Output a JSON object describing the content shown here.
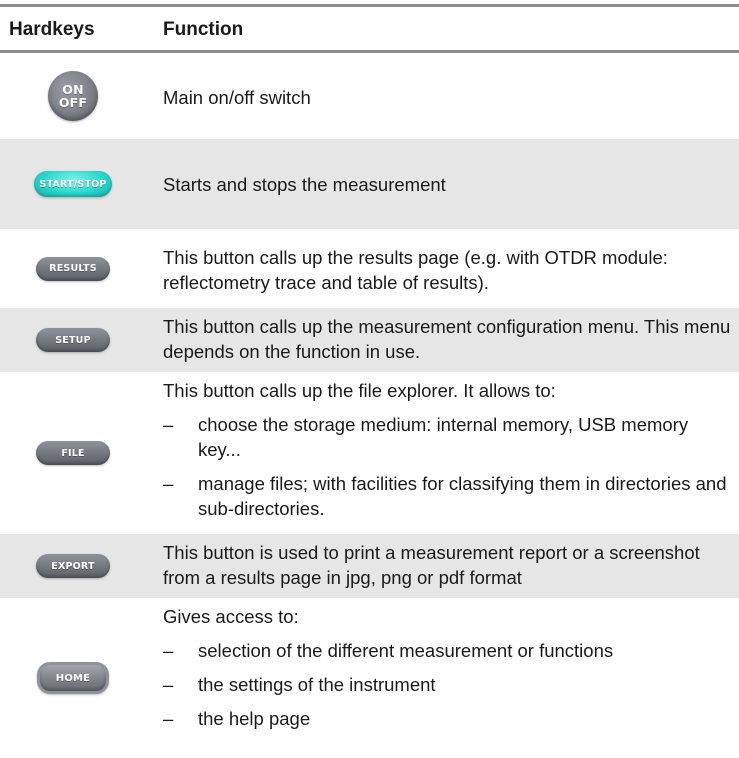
{
  "header": {
    "col1": "Hardkeys",
    "col2": "Function"
  },
  "rows": [
    {
      "key_label_top": "ON",
      "key_label_bottom": "OFF",
      "text": "Main on/off switch"
    },
    {
      "key_label": "START/STOP",
      "text": "Starts and stops the measurement"
    },
    {
      "key_label": "RESULTS",
      "text": "This button calls up the results page (e.g. with OTDR module: reflectometry trace and table of results)."
    },
    {
      "key_label": "SETUP",
      "text": "This button calls up the measurement configuration menu. This menu depends on the function in use."
    },
    {
      "key_label": "FILE",
      "intro": "This button calls up the file explorer. It allows to:",
      "bullets": [
        "choose the storage medium: internal memory, USB memory key...",
        "manage files; with facilities for classifying them in directories and sub-directories."
      ]
    },
    {
      "key_label": "EXPORT",
      "text": "This button is used to print a measurement report or a screenshot from a results page in jpg, png or pdf format"
    },
    {
      "key_label": "HOME",
      "intro": "Gives access to:",
      "bullets": [
        "selection of the different measurement or functions",
        "the settings of the instrument",
        "the help page"
      ]
    }
  ],
  "dash": "–",
  "colors": {
    "rule": "#8c8c8c",
    "shade": "#e6e6e6",
    "cyan_key": "#2ad6cc",
    "gray_key": "#7c8087"
  }
}
